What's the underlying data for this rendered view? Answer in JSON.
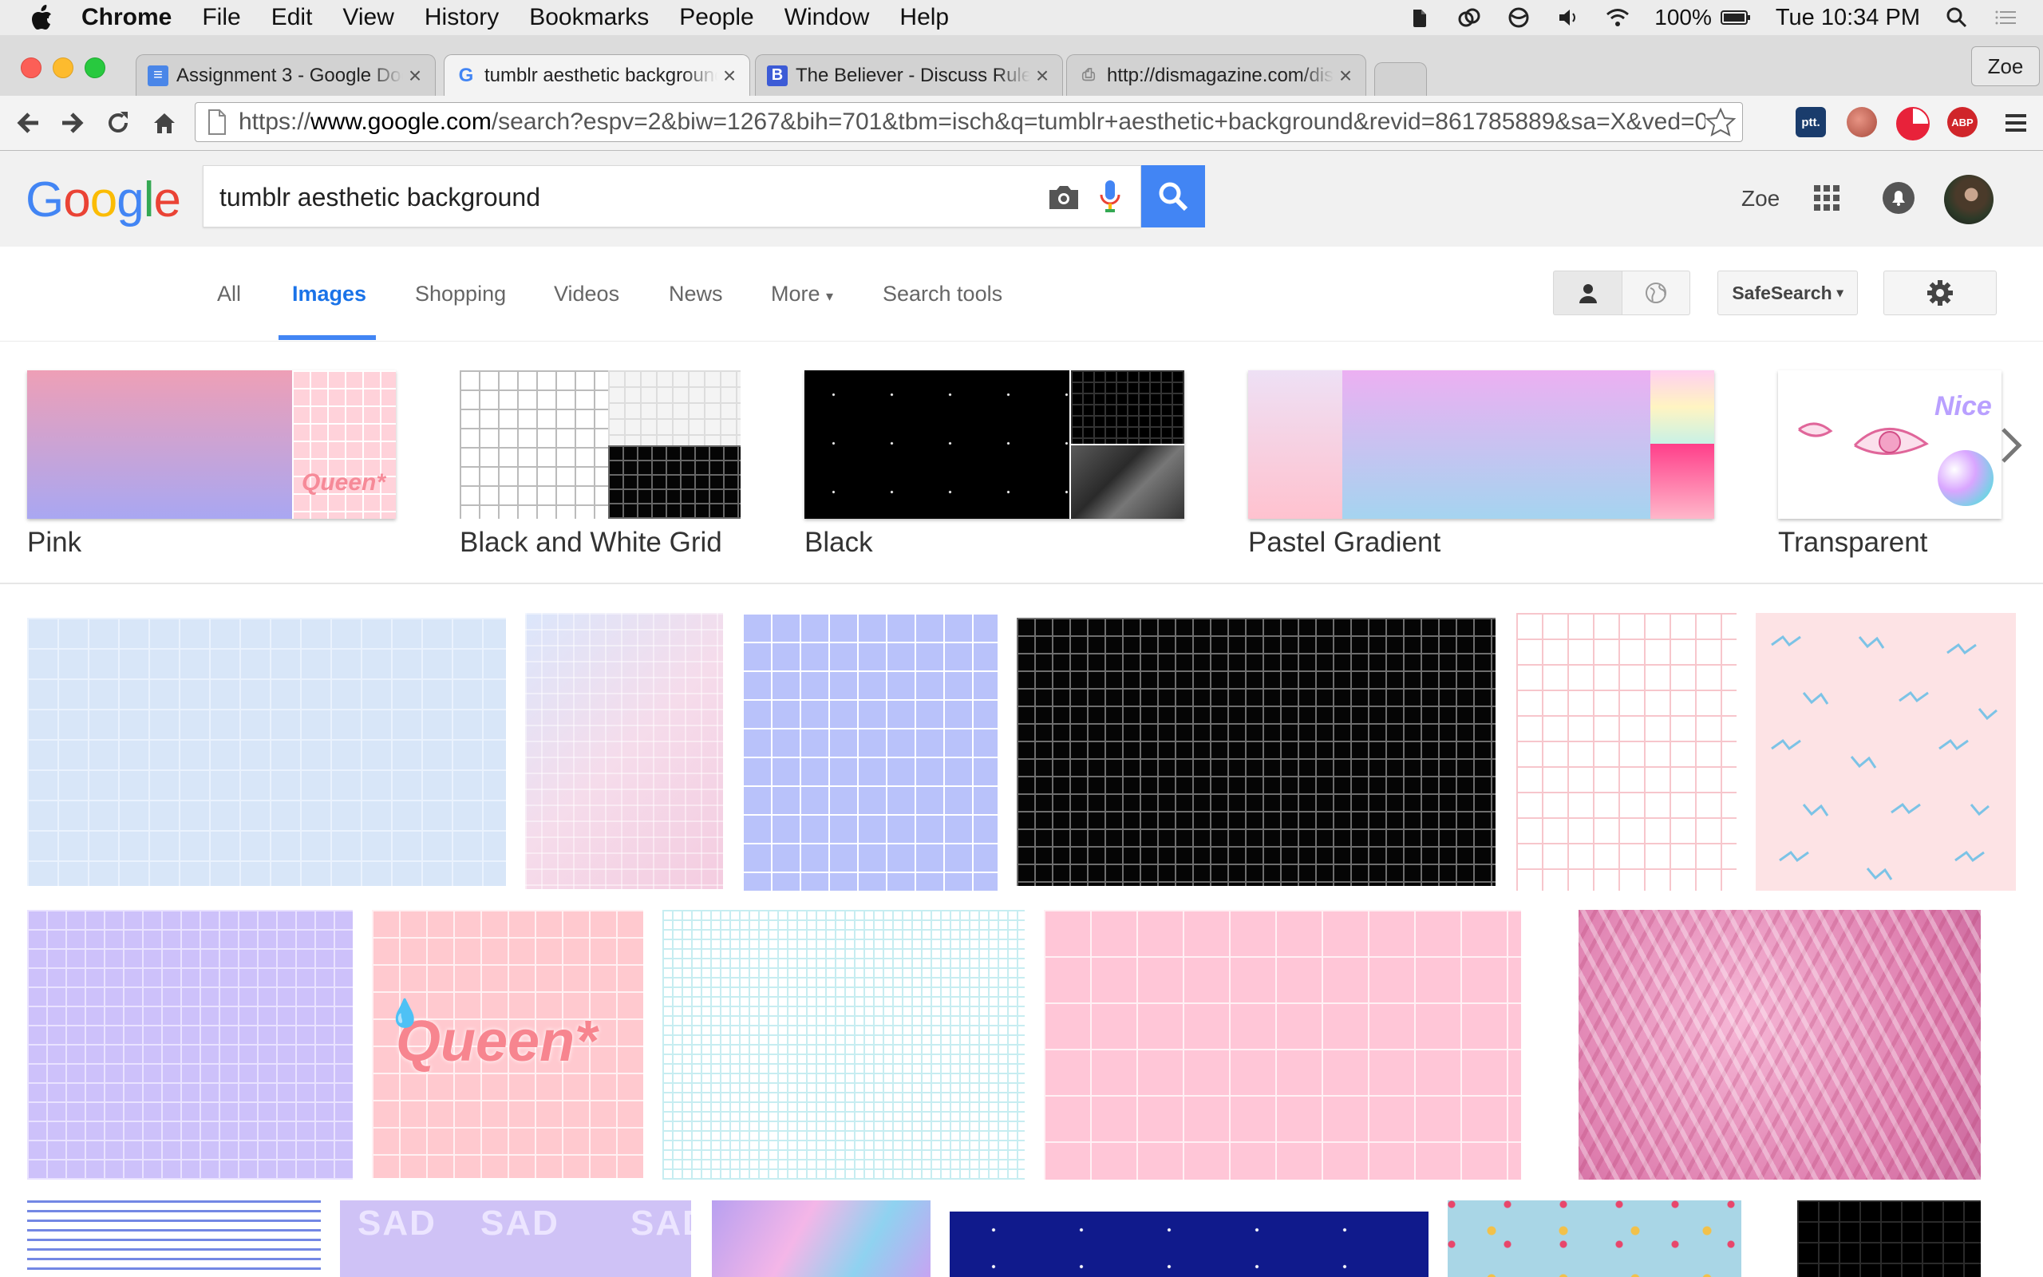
{
  "menubar": {
    "app": "Chrome",
    "menus": [
      "File",
      "Edit",
      "View",
      "History",
      "Bookmarks",
      "People",
      "Window",
      "Help"
    ],
    "battery": "100%",
    "clock": "Tue 10:34 PM"
  },
  "tabs": [
    {
      "title": "Assignment 3 - Google Docs",
      "favicon": "docs-icon"
    },
    {
      "title": "tumblr aesthetic background - Google Search",
      "favicon": "google-icon"
    },
    {
      "title": "The Believer - Discuss Rules",
      "favicon": "believer-icon"
    },
    {
      "title": "http://dismagazine.com/dis",
      "favicon": "page-icon"
    }
  ],
  "profile_button": "Zoe",
  "address": {
    "scheme": "https://",
    "host": "www.google.com",
    "path": "/search?espv=2&biw=1267&bih=701&tbm=isch&q=tumblr+aesthetic+background&revid=861785889&sa=X&ved=0ah…"
  },
  "extensions": [
    {
      "name": "ptt-extension-icon",
      "label": "ptt.",
      "color": "#1a3c6c"
    },
    {
      "name": "apple-extension-icon",
      "label": "",
      "color": "#c86a58"
    },
    {
      "name": "pie-extension-icon",
      "label": "",
      "color": "#e8223a"
    },
    {
      "name": "adblock-extension-icon",
      "label": "ABP",
      "color": "#d0252a"
    }
  ],
  "search": {
    "query": "tumblr aesthetic background",
    "user": "Zoe"
  },
  "nav_tabs": [
    "All",
    "Images",
    "Shopping",
    "Videos",
    "News",
    "More",
    "Search tools"
  ],
  "safesearch": "SafeSearch",
  "suggestions": [
    "Pink",
    "Black and White Grid",
    "Black",
    "Pastel Gradient",
    "Transparent"
  ],
  "thumb_text": {
    "queen": "Queen*",
    "nice": "Nice",
    "sad": "SAD"
  }
}
